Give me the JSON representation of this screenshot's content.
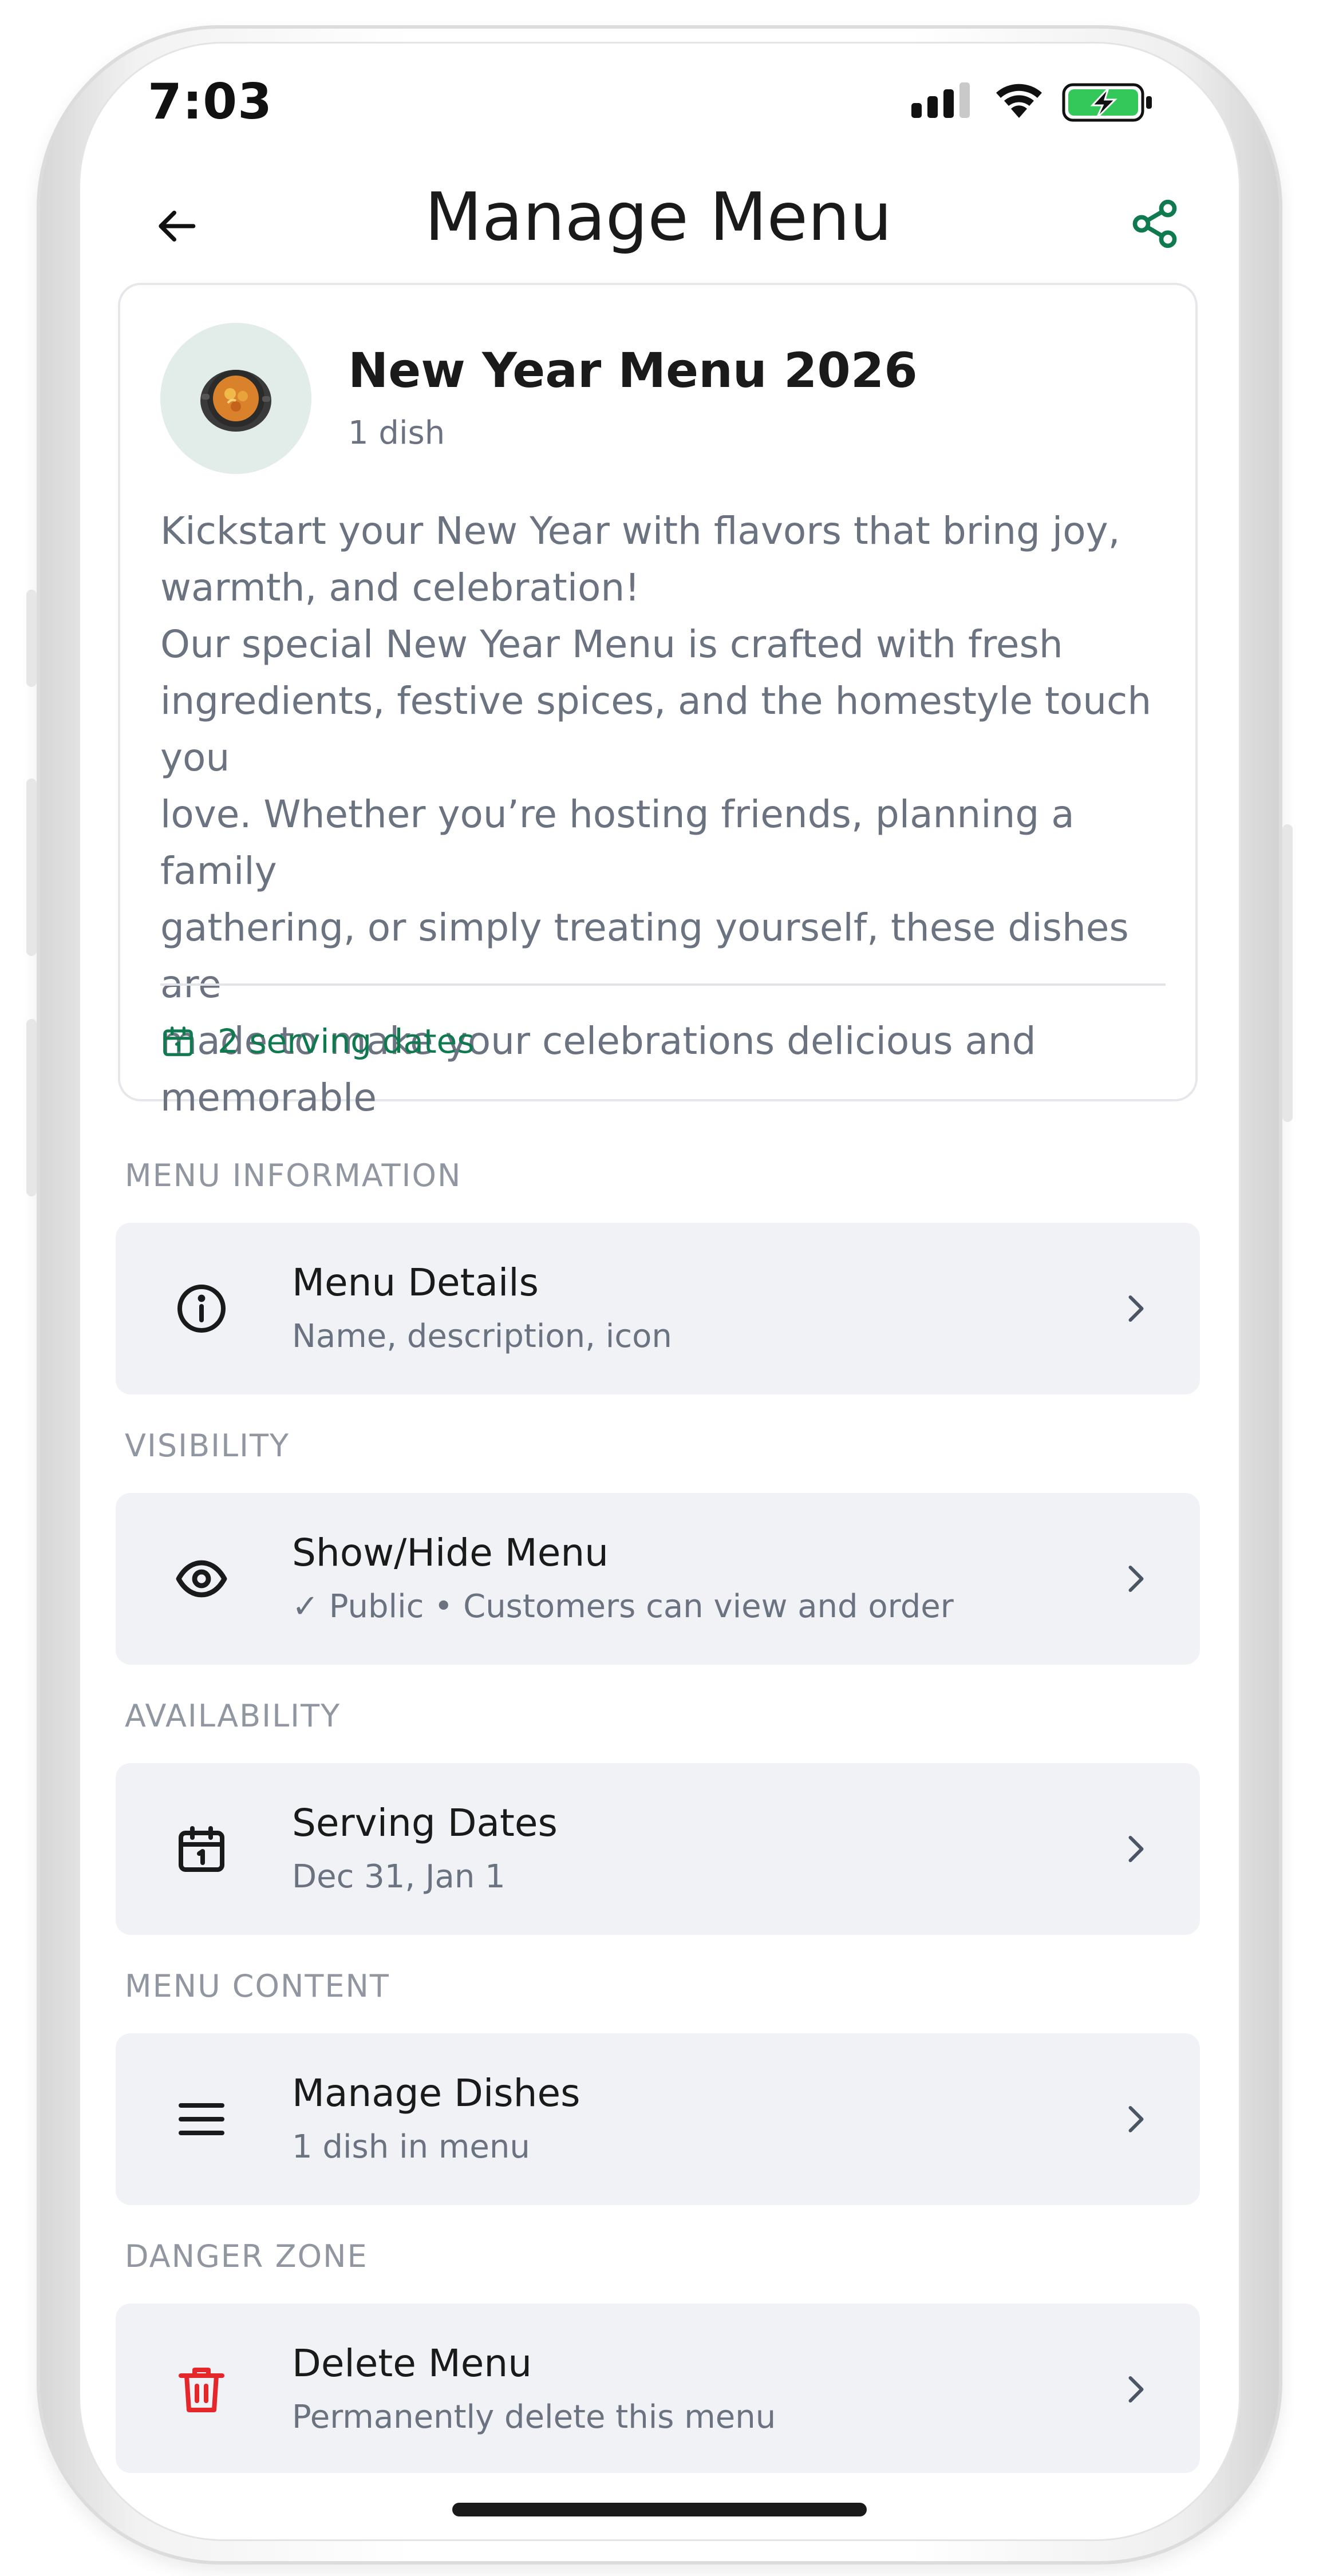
{
  "status_bar": {
    "time": "7:03",
    "icons": [
      "cellular-signal-icon",
      "wifi-icon",
      "battery-charging-icon"
    ],
    "battery_color": "#34c759"
  },
  "header": {
    "title": "Manage Menu",
    "back_icon": "arrow-left-icon",
    "share_icon": "share-icon"
  },
  "menu": {
    "icon": "paella-pan-icon",
    "name": "New Year Menu 2026",
    "dish_count": "1 dish",
    "description": "Kickstart your New Year with flavors that bring joy,\nwarmth, and celebration!\nOur special New Year Menu is crafted with fresh\ningredients, festive spices, and the homestyle touch you\nlove. Whether you’re hosting friends, planning a family\ngathering, or simply treating yourself, these dishes are\nmade to make your celebrations delicious and\nmemorable",
    "serving_dates_label": "2 serving dates"
  },
  "sections": [
    {
      "label": "MENU INFORMATION",
      "item": {
        "icon": "info-icon",
        "title": "Menu Details",
        "subtitle": "Name, description, icon"
      }
    },
    {
      "label": "VISIBILITY",
      "item": {
        "icon": "eye-icon",
        "title": "Show/Hide Menu",
        "subtitle": "✓ Public • Customers can view and order"
      }
    },
    {
      "label": "AVAILABILITY",
      "item": {
        "icon": "calendar-icon",
        "title": "Serving Dates",
        "subtitle": "Dec 31, Jan 1"
      }
    },
    {
      "label": "MENU CONTENT",
      "item": {
        "icon": "list-icon",
        "title": "Manage Dishes",
        "subtitle": "1 dish in menu"
      }
    },
    {
      "label": "DANGER ZONE",
      "item": {
        "icon": "trash-icon",
        "title": "Delete Menu",
        "subtitle": "Permanently delete this menu"
      }
    }
  ],
  "colors": {
    "accent_green": "#0f7a4f",
    "danger_red": "#e5262a",
    "row_background": "#f0f2f6",
    "muted_text": "#6b7280",
    "section_label": "#9097a0"
  }
}
